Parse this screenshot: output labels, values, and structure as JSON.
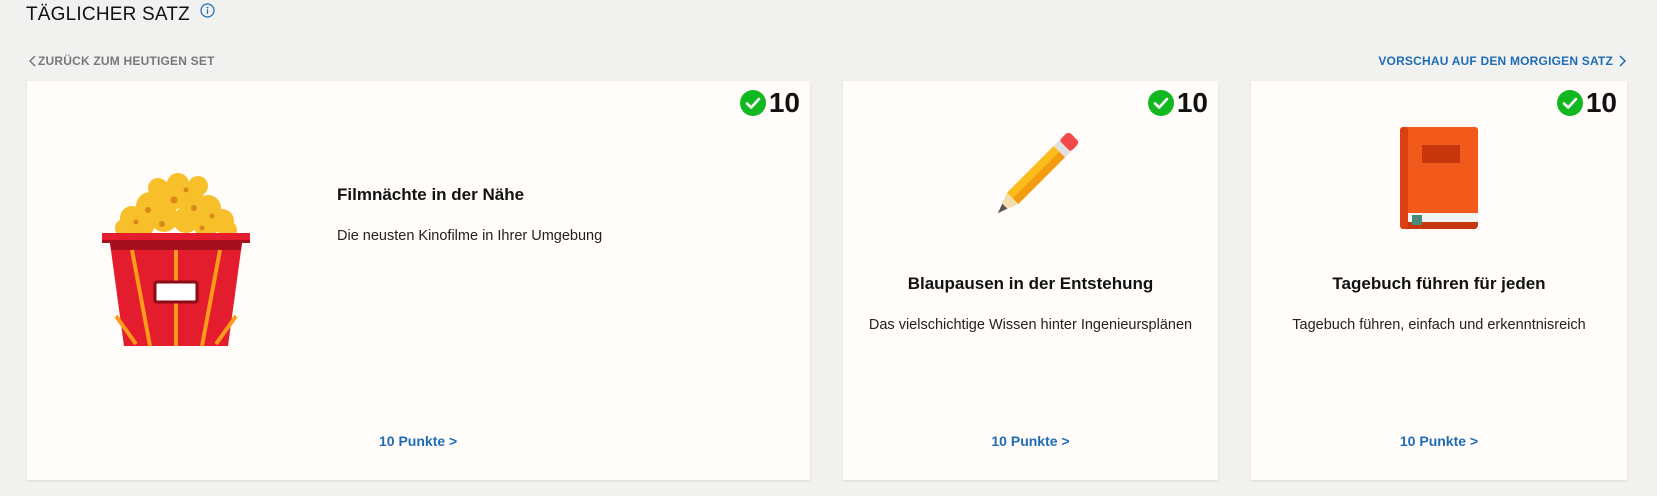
{
  "header": {
    "title": "TÄGLICHER SATZ",
    "info_icon": "info-circle-icon"
  },
  "nav": {
    "back_label": "ZURÜCK ZUM HEUTIGEN SET",
    "next_label": "VORSCHAU AUF DEN MORGIGEN SATZ"
  },
  "cards": [
    {
      "badge_count": "10",
      "icon": "popcorn-icon",
      "title": "Filmnächte in der Nähe",
      "description": "Die neusten Kinofilme in Ihrer Umgebung",
      "link": "10 Punkte >"
    },
    {
      "badge_count": "10",
      "icon": "pencil-icon",
      "title": "Blaupausen in der Entstehung",
      "description": "Das vielschichtige Wissen hinter Ingenieursplänen",
      "link": "10 Punkte >"
    },
    {
      "badge_count": "10",
      "icon": "book-icon",
      "title": "Tagebuch führen für jeden",
      "description": "Tagebuch führen, einfach und erkenntnisreich",
      "link": "10 Punkte >"
    }
  ],
  "colors": {
    "accent": "#1f6bb5",
    "check_green": "#12b81f",
    "card_bg": "#fffcf9",
    "page_bg": "#f1f2f0"
  }
}
